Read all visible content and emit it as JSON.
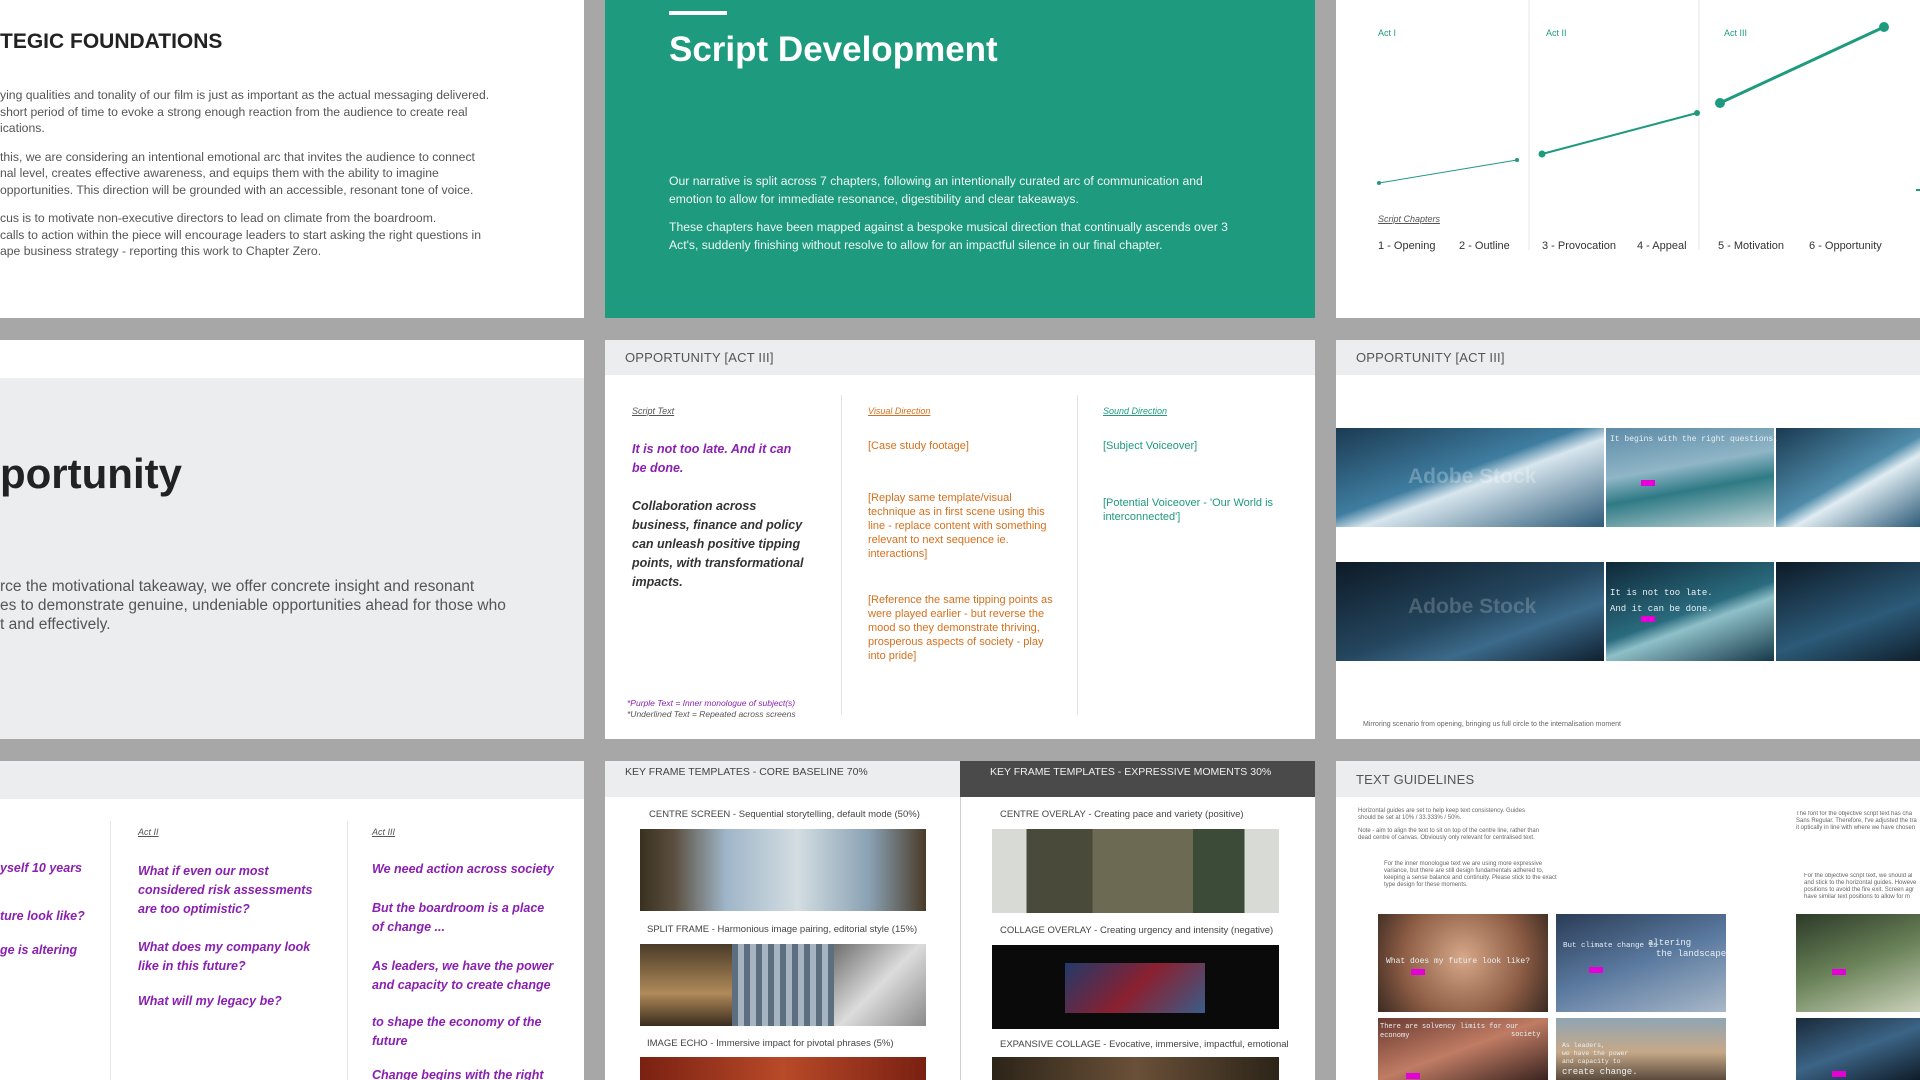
{
  "slide_strategic": {
    "title": "TEGIC FOUNDATIONS",
    "p1": "ying qualities and tonality of our film is just as important as the actual messaging delivered.",
    "p1b": "short period of time to evoke a strong enough reaction from the audience to create real",
    "p1c": "ications.",
    "p2": "this, we are considering an intentional emotional arc that invites the audience to connect",
    "p2b": "nal level, creates effective awareness, and equips them with the ability to imagine",
    "p2c": "opportunities. This direction will be grounded with an accessible, resonant tone of voice.",
    "p3": "cus is to motivate non-executive directors to lead on climate from the boardroom.",
    "p3b": "calls to action within the piece will encourage leaders to start asking the right questions in",
    "p3c": "ape business strategy - reporting this work to Chapter Zero."
  },
  "slide_script": {
    "title": "Script Development",
    "p1a": "Our narrative is split across 7 chapters, following an intentionally curated arc of communication and",
    "p1b": "emotion to allow for immediate resonance, digestibility and clear takeaways.",
    "p2a": "These chapters have been mapped against a bespoke musical direction that continually ascends over 3",
    "p2b": "Act's, suddenly finishing without resolve to allow for an impactful silence in our final chapter."
  },
  "slide_chart": {
    "acts": [
      "Act I",
      "Act II",
      "Act III"
    ],
    "section_label": "Script Chapters",
    "chapters": [
      "1 - Opening",
      "2 - Outline",
      "3 - Provocation",
      "4 - Appeal",
      "5 - Motivation",
      "6 - Opportunity"
    ],
    "colors": {
      "line": "#1e9a7e"
    }
  },
  "slide_opportunity_title": {
    "title": "portunity",
    "body_a": "rce the motivational takeaway, we offer concrete insight and resonant",
    "body_b": "es to demonstrate genuine, undeniable opportunities ahead for those who",
    "body_c": "t and effectively."
  },
  "slide_opportunity_table": {
    "header": "OPPORTUNITY  [ACT III]",
    "col1_label": "Script Text",
    "col2_label": "Visual Direction",
    "col3_label": "Sound Direction",
    "script1": "It is not too late. And it can be done.",
    "script2": "Collaboration across business, finance and policy can unleash positive tipping points, with transformational impacts.",
    "visual1": "[Case study footage]",
    "visual2": "[Replay same template/visual technique as in first scene using this line - replace content with something relevant to next sequence ie. interactions]",
    "visual3": "[Reference the same tipping points as were played earlier - but reverse the mood so they demonstrate thriving, prosperous aspects of society - play into pride]",
    "sound1": "[Subject Voiceover]",
    "sound2": "[Potential Voiceover - 'Our World is interconnected']",
    "legend1": "*Purple Text = Inner monologue of subject(s)",
    "legend2": "*Underlined Text = Repeated across screens"
  },
  "slide_opportunity_frames": {
    "header": "OPPORTUNITY [ACT III]",
    "cap1": "It begins with the right questions.",
    "cap2a": "It    is    not    too    late.",
    "cap2b": "And    it    can    be    done.",
    "watermark": "Adobe Stock",
    "footer": "Mirroring scenario from opening, bringing us full circle to the internalisation moment"
  },
  "slide_acts": {
    "act2": "Act II",
    "act3": "Act III",
    "col1": [
      "yself 10 years",
      "ture look like?",
      "ge is altering"
    ],
    "col2": [
      "What if even our most considered risk assessments are too optimistic?",
      "What does my company look like in this future?",
      "What will my legacy be?"
    ],
    "col3": [
      "We need action across society",
      "But the boardroom is a place of change ...",
      "As leaders, we have the power and capacity to create change",
      "to shape the economy of the future",
      "Change begins with the right"
    ]
  },
  "slide_keyframes": {
    "head_left": "KEY FRAME TEMPLATES - CORE BASELINE 70%",
    "head_right": "KEY FRAME TEMPLATES - EXPRESSIVE MOMENTS 30%",
    "l1": "CENTRE SCREEN - Sequential storytelling, default mode (50%)",
    "l2": "SPLIT FRAME - Harmonious image pairing, editorial style (15%)",
    "l3": "IMAGE ECHO - Immersive impact for pivotal phrases (5%)",
    "r1": "CENTRE OVERLAY - Creating pace and variety (positive)",
    "r2": "COLLAGE OVERLAY - Creating urgency and intensity  (negative)",
    "r3": "EXPANSIVE COLLAGE - Evocative, immersive, impactful, emotional"
  },
  "slide_text_guidelines": {
    "header": "TEXT GUIDELINES",
    "note1": "Horizontal guides are set to help keep text consistency. Guides should be set at 10% / 33.333% / 50%.",
    "note2": "Note - aim to align the text to sit on top of the centre line, rather than dead centre of canvas. Obviously only relevant for centralised text.",
    "note3": "For the inner monologue text we are using more expressive variance, but there are still design fundamentals adhered to, keeping a sense balance and continuity. Please stick to the exact type design for these moments.",
    "note_right1": "The font for the objective script text has cha Sans Regular. Therefore, I've adjusted the tra it optically in line with where we have chosen",
    "note_right2": "For the objective script text, we should al and stick to the horizontal guides. Howeve positions to avoid the fire exit. Screen agr have similar text positions to allow for m",
    "cap1": "What  does  my  future  look  like?",
    "cap2a": "But climate change is",
    "cap2b": "altering",
    "cap2c": "the landscape",
    "cap3": "There   are   solvency   limits   for   our economy",
    "cap3b": "society",
    "cap4a": "As leaders,",
    "cap4b": "we have the power",
    "cap4c": "and capacity to",
    "cap4d": "create  change."
  }
}
